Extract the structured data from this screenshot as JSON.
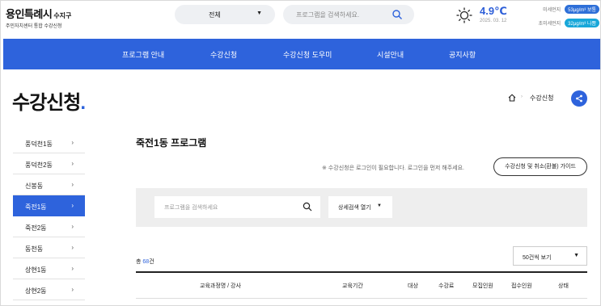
{
  "header": {
    "logo_main": "용인특례시",
    "logo_region": "수지구",
    "logo_sub": "주민자치센터 통합 수강신청",
    "region_select": "전체",
    "search_placeholder": "프로그램을 검색하세요.",
    "temperature": "4.9℃",
    "weather_date": "2025. 03. 12",
    "fine_dust_label": "미세먼지",
    "fine_dust_value": "53μg/m³ 보통",
    "ultrafine_dust_label": "초미세먼지",
    "ultrafine_dust_value": "32μg/m³ 나쁨"
  },
  "nav": {
    "items": [
      "프로그램 안내",
      "수강신청",
      "수강신청 도우미",
      "시설안내",
      "공지사항"
    ]
  },
  "page": {
    "title": "수강신청",
    "breadcrumb": "수강신청"
  },
  "sidebar": {
    "items": [
      {
        "label": "풍덕천1동"
      },
      {
        "label": "풍덕천2동"
      },
      {
        "label": "신봉동"
      },
      {
        "label": "죽전1동"
      },
      {
        "label": "죽전2동"
      },
      {
        "label": "동천동"
      },
      {
        "label": "상현1동"
      },
      {
        "label": "상현2동"
      }
    ],
    "active_index": 3
  },
  "main": {
    "program_title": "죽전1동 프로그램",
    "notice": "※ 수강신청은 로그인이 필요합니다. 로그인을 먼저 해주세요.",
    "guide_button": "수강신청 및 취소(환불) 가이드",
    "filter_placeholder": "프로그램을 검색하세요",
    "detail_search": "상세검색 열기",
    "total_prefix": "총",
    "total_count": "68",
    "total_suffix": "건",
    "per_page": "50건씩 보기",
    "columns": [
      "교육과정명 / 강사",
      "교육기간",
      "대상",
      "수강료",
      "모집인원",
      "접수인원",
      "상태"
    ]
  },
  "colors": {
    "primary": "#2e63dc",
    "badge_normal": "#2e6fd8",
    "badge_bad": "#18a7d9"
  },
  "icons": [
    "sun-icon",
    "search-icon",
    "chevron-down-icon",
    "home-icon",
    "share-icon",
    "chevron-right-icon"
  ]
}
